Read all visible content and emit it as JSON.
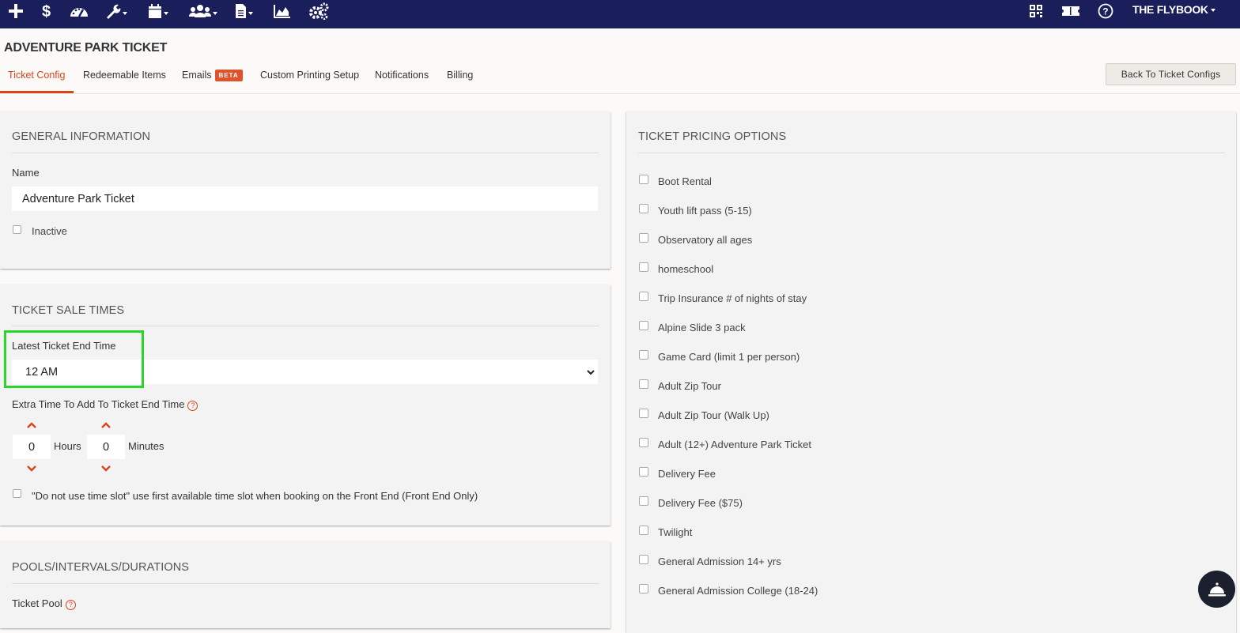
{
  "nav": {
    "icons": [
      "plus-icon",
      "dollar-icon",
      "dashboard-icon",
      "wrench-icon",
      "calendar-icon",
      "users-icon",
      "document-icon",
      "chart-icon",
      "gears-icon"
    ],
    "right_icons": [
      "qr-code-icon",
      "ticket-icon",
      "help-icon"
    ],
    "account_name": "THE FLYBOOK"
  },
  "header": {
    "title": "ADVENTURE PARK TICKET",
    "back_button": "Back To Ticket Configs",
    "tabs": [
      {
        "label": "Ticket Config",
        "active": true
      },
      {
        "label": "Redeemable Items"
      },
      {
        "label": "Emails",
        "badge": "BETA"
      },
      {
        "label": "Custom Printing Setup"
      },
      {
        "label": "Notifications"
      },
      {
        "label": "Billing"
      }
    ]
  },
  "general": {
    "title": "GENERAL INFORMATION",
    "name_label": "Name",
    "name_value": "Adventure Park Ticket",
    "inactive_label": "Inactive"
  },
  "sale_times": {
    "title": "TICKET SALE TIMES",
    "end_time_label": "Latest Ticket End Time",
    "end_time_value": "12 AM",
    "extra_label": "Extra Time To Add To Ticket End Time",
    "hours_value": "0",
    "hours_label": "Hours",
    "minutes_value": "0",
    "minutes_label": "Minutes",
    "no_slot_label": "\"Do not use time slot\" use first available time slot when booking on the Front End (Front End Only)"
  },
  "pools": {
    "title": "POOLS/INTERVALS/DURATIONS",
    "pool_label": "Ticket Pool"
  },
  "pricing": {
    "title": "TICKET PRICING OPTIONS",
    "options": [
      "Boot Rental",
      "Youth lift pass (5-15)",
      "Observatory all ages",
      "homeschool",
      "Trip Insurance # of nights of stay",
      "Alpine Slide 3 pack",
      "Game Card (limit 1 per person)",
      "Adult Zip Tour",
      "Adult Zip Tour (Walk Up)",
      "Adult (12+) Adventure Park Ticket",
      "Delivery Fee",
      "Delivery Fee ($75)",
      "Twilight",
      "General Admission 14+ yrs",
      "General Admission College (18-24)"
    ]
  },
  "colors": {
    "nav_bg": "#1a1f5c",
    "accent": "#d9441c",
    "highlight": "#2ad62a"
  }
}
